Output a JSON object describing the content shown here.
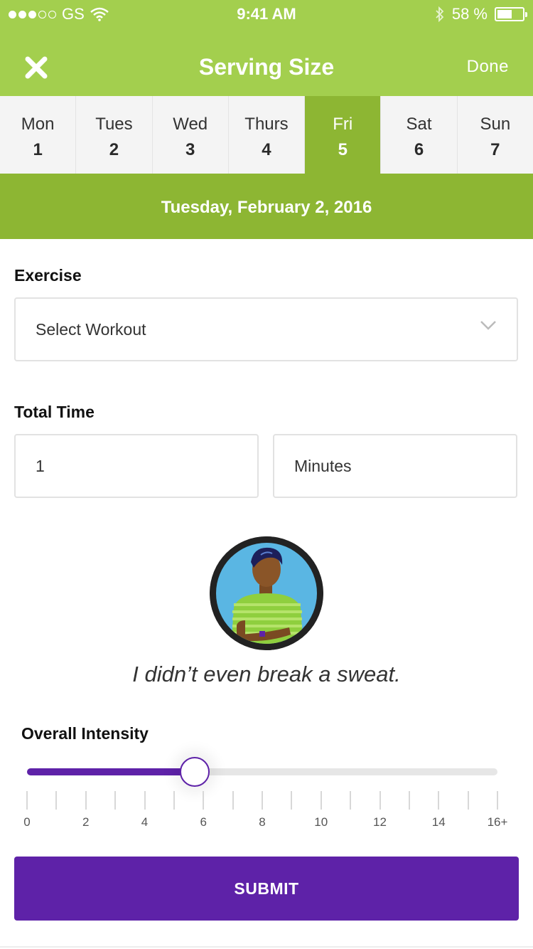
{
  "status_bar": {
    "carrier": "GS",
    "time": "9:41 AM",
    "battery": "58 %"
  },
  "nav": {
    "title": "Serving Size",
    "done_label": "Done",
    "close_icon": "close-icon"
  },
  "days": [
    {
      "name": "Mon",
      "num": "1",
      "active": false
    },
    {
      "name": "Tues",
      "num": "2",
      "active": false
    },
    {
      "name": "Wed",
      "num": "3",
      "active": false
    },
    {
      "name": "Thurs",
      "num": "4",
      "active": false
    },
    {
      "name": "Fri",
      "num": "5",
      "active": true
    },
    {
      "name": "Sat",
      "num": "6",
      "active": false
    },
    {
      "name": "Sun",
      "num": "7",
      "active": false
    }
  ],
  "selected_date": "Tuesday, February 2, 2016",
  "exercise": {
    "label": "Exercise",
    "select_value": "Select Workout"
  },
  "total_time": {
    "label": "Total Time",
    "value": "1",
    "unit": "Minutes"
  },
  "feedback_quote": "I didn’t even break a sweat.",
  "intensity": {
    "label": "Overall Intensity",
    "value": 5.7,
    "min": 0,
    "max": 16,
    "tick_labels": [
      "0",
      "2",
      "4",
      "6",
      "8",
      "10",
      "12",
      "14",
      "16+"
    ]
  },
  "submit_label": "SUBMIT",
  "colors": {
    "brand_green": "#a3cf4e",
    "dark_green": "#8db633",
    "accent_purple": "#5e22a8"
  }
}
